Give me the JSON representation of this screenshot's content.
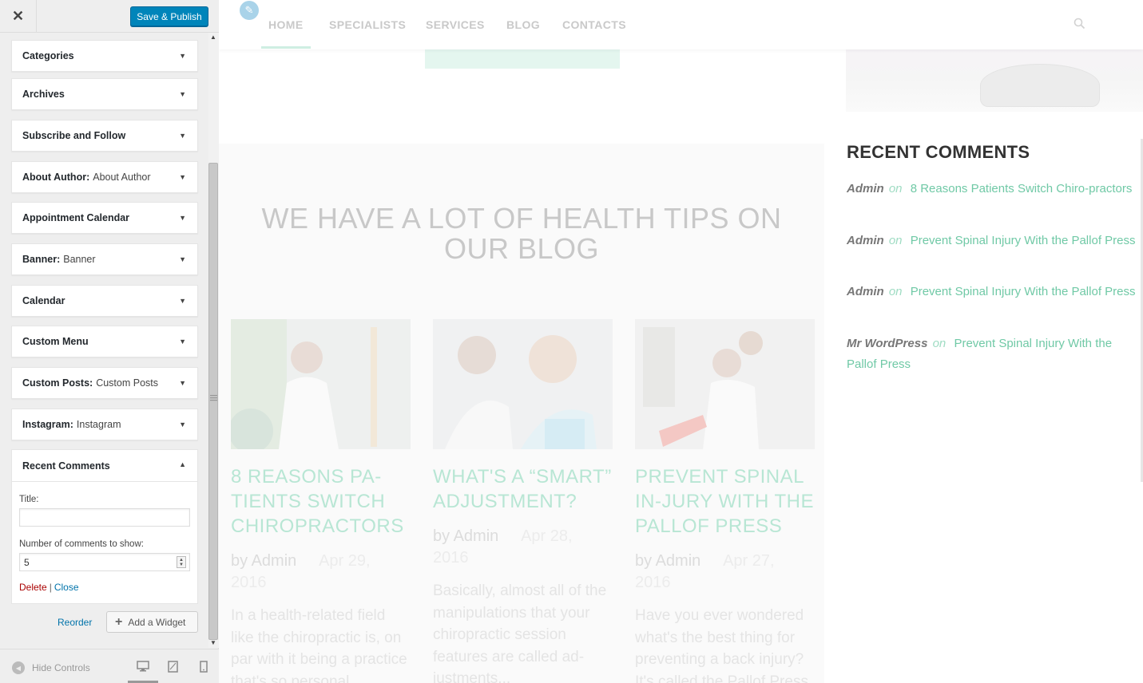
{
  "customizer": {
    "close_icon": "close-icon",
    "save_label": "Save & Publish",
    "widgets": [
      {
        "title": "Categories",
        "sub": ""
      },
      {
        "title": "Archives",
        "sub": ""
      },
      {
        "title": "Subscribe and Follow",
        "sub": ""
      },
      {
        "title": "About Author:",
        "sub": "About Author"
      },
      {
        "title": "Appointment Calendar",
        "sub": ""
      },
      {
        "title": "Banner:",
        "sub": "Banner"
      },
      {
        "title": "Calendar",
        "sub": ""
      },
      {
        "title": "Custom Menu",
        "sub": ""
      },
      {
        "title": "Custom Posts:",
        "sub": "Custom Posts"
      },
      {
        "title": "Instagram:",
        "sub": "Instagram"
      }
    ],
    "open_widget": {
      "title": "Recent Comments",
      "title_label": "Title:",
      "title_value": "",
      "count_label": "Number of comments to show:",
      "count_value": "5",
      "delete_label": "Delete",
      "separator": "|",
      "close_label": "Close"
    },
    "reorder_label": "Reorder",
    "add_widget_label": "Add a Widget",
    "hide_controls_label": "Hide Controls",
    "devices": [
      "desktop-icon",
      "tablet-icon",
      "mobile-icon"
    ],
    "active_device": "desktop"
  },
  "preview": {
    "nav": {
      "items": [
        "HOME",
        "SPECIALISTS",
        "SERVICES",
        "BLOG",
        "CONTACTS"
      ],
      "active": "HOME"
    },
    "blog_heading": "WE HAVE A LOT OF HEALTH TIPS ON OUR BLOG",
    "posts": [
      {
        "title": "8 REASONS PA-TIENTS SWITCH CHIROPRACTORS",
        "author": "by Admin",
        "date": "Apr 29, 2016",
        "excerpt": "In a health-related field like the chiropractic is, on par with it being a practice that's so personal"
      },
      {
        "title": "WHAT'S A “SMART” ADJUSTMENT?",
        "author": "by Admin",
        "date": "Apr 28, 2016",
        "excerpt": "Basically, almost all of the manipulations that your chiropractic session features are called ad-justments..."
      },
      {
        "title": "PREVENT SPINAL IN-JURY WITH THE PALLOF PRESS",
        "author": "by Admin",
        "date": "Apr 27, 2016",
        "excerpt": "Have you ever wondered what's the best thing for preventing a back injury? It's called the Pallof Press"
      }
    ],
    "recent_comments": {
      "heading": "RECENT COMMENTS",
      "items": [
        {
          "author": "Admin",
          "on": "on",
          "link": "8 Reasons Patients Switch Chiro-practors"
        },
        {
          "author": "Admin",
          "on": "on",
          "link": "Prevent Spinal Injury With the Pallof Press"
        },
        {
          "author": "Admin",
          "on": "on",
          "link": "Prevent Spinal Injury With the Pallof Press"
        },
        {
          "author": "Mr WordPress",
          "on": "on",
          "link": "Prevent Spinal Injury With the Pallof Press"
        }
      ]
    },
    "colors": {
      "accent": "#70c9a6",
      "primary_button": "#0085ba",
      "delete": "#aa0000"
    }
  }
}
